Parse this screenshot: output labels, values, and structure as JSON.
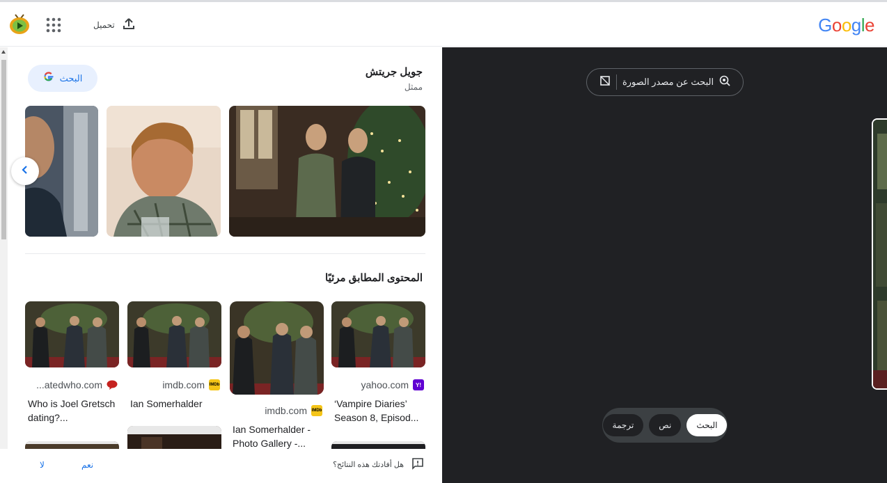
{
  "header": {
    "upload_label": "تحميل",
    "logo": {
      "letters": [
        "G",
        "o",
        "o",
        "g",
        "l",
        "e"
      ],
      "colors": [
        "#4285f4",
        "#ea4335",
        "#fbbc05",
        "#4285f4",
        "#34a853",
        "#ea4335"
      ]
    }
  },
  "entity": {
    "name": "جويل جريتش",
    "subtitle": "ممثل",
    "search_chip_label": "البحث"
  },
  "visual_matches": {
    "title": "المحتوى المطابق مرئيًا",
    "results": [
      {
        "source": "yahoo.com",
        "favicon": "Y!",
        "favicon_color": "#6001d2",
        "title": "‘Vampire Diaries’ Season 8, Episod..."
      },
      {
        "source": "imdb.com",
        "favicon": "IMDb",
        "favicon_color": "#f5c518",
        "title": "Ian Somerhalder - Photo Gallery -..."
      },
      {
        "source": "imdb.com",
        "favicon": "IMDb",
        "favicon_color": "#f5c518",
        "title": "Ian Somerhalder"
      },
      {
        "source": "...atedwho.com",
        "favicon": "",
        "favicon_color": "#c5221f",
        "title": "Who is Joel Gretsch dating?..."
      }
    ]
  },
  "feedback": {
    "question": "هل أفادتك هذه النتائج؟",
    "yes": "نعم",
    "no": "لا"
  },
  "lens": {
    "source_button_label": "البحث عن مصدر الصورة",
    "modes": [
      "البحث",
      "نص",
      "ترجمة"
    ],
    "active_mode": "البحث"
  },
  "colors": {
    "accent": "#1a73e8",
    "dark_bg": "#202124"
  }
}
